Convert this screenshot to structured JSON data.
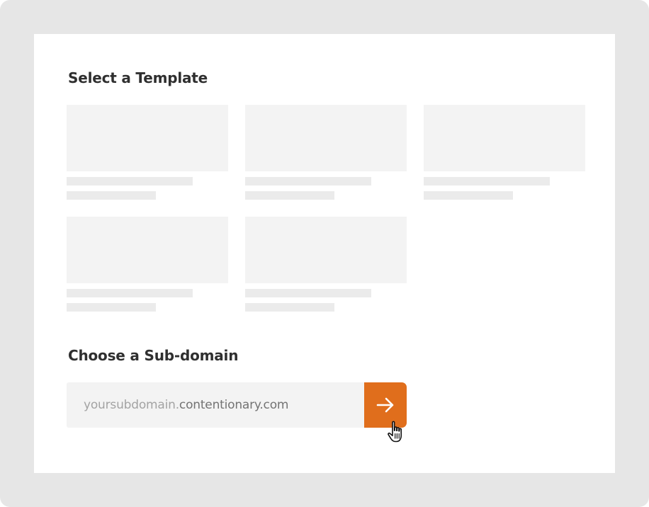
{
  "headings": {
    "templates": "Select a Template",
    "subdomain": "Choose a Sub-domain"
  },
  "templates": {
    "count": 5,
    "state": "loading-placeholder"
  },
  "subdomain_field": {
    "placeholder_prefix": "yoursubdomain.",
    "domain_suffix": "contentionary.com"
  },
  "submit_button": {
    "icon": "arrow-right-icon",
    "color": "#e06e1c"
  },
  "cursor": {
    "icon": "hand-pointer-cursor-icon"
  }
}
